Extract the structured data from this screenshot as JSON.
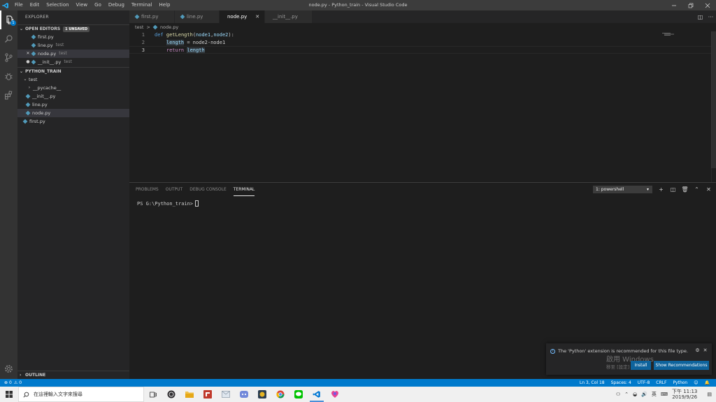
{
  "window": {
    "title": "node.py - Python_train - Visual Studio Code",
    "controls": [
      "minimize",
      "restore",
      "close"
    ]
  },
  "menu": [
    "File",
    "Edit",
    "Selection",
    "View",
    "Go",
    "Debug",
    "Terminal",
    "Help"
  ],
  "activity": {
    "explorer_badge": "1"
  },
  "sidebar": {
    "title": "EXPLORER",
    "open_editors": {
      "label": "OPEN EDITORS",
      "badge": "1 UNSAVED",
      "items": [
        {
          "name": "first.py",
          "desc": ""
        },
        {
          "name": "line.py",
          "desc": "test"
        },
        {
          "name": "node.py",
          "desc": "test"
        },
        {
          "name": "__init__.py",
          "desc": "test"
        }
      ]
    },
    "project": {
      "label": "PYTHON_TRAIN",
      "items": [
        {
          "name": "test"
        },
        {
          "name": "__pycache__"
        },
        {
          "name": "__init__.py"
        },
        {
          "name": "line.py"
        },
        {
          "name": "node.py"
        },
        {
          "name": "first.py"
        }
      ]
    },
    "outline": "OUTLINE"
  },
  "tabs": [
    {
      "label": "first.py"
    },
    {
      "label": "line.py"
    },
    {
      "label": "node.py"
    },
    {
      "label": "__init__.py"
    }
  ],
  "breadcrumb": {
    "folder": "test",
    "sep": ">",
    "file": "node.py"
  },
  "code": {
    "line_numbers": [
      "1",
      "2",
      "3"
    ],
    "line1": {
      "kw": "def",
      "fn": "getLength",
      "open": "(",
      "p1": "node1",
      "comma": ",",
      "p2": "node2",
      "close": "):"
    },
    "line2": {
      "indent": "    ",
      "var": "length",
      "rest": " = node2-node1"
    },
    "line3": {
      "indent": "    ",
      "kw": "return",
      "sp": " ",
      "var": "length"
    }
  },
  "panel": {
    "tabs": [
      "PROBLEMS",
      "OUTPUT",
      "DEBUG CONSOLE",
      "TERMINAL"
    ],
    "terminal_select": "1: powershell",
    "prompt": "PS G:\\Python_train>"
  },
  "notification": {
    "message": "The 'Python' extension is recommended for this file type.",
    "install": "Install",
    "show_recommendations": "Show Recommendations",
    "watermark_line1": "啟用 Windows",
    "watermark_line2": "移至 [設定] 以啟用"
  },
  "status": {
    "errors": "0",
    "warnings": "0",
    "position": "Ln 3, Col 18",
    "spaces": "Spaces: 4",
    "encoding": "UTF-8",
    "eol": "CRLF",
    "language": "Python"
  },
  "taskbar": {
    "search_placeholder": "在這裡輸入文字來搜尋",
    "ime": "英",
    "time": "下午 11:13",
    "date": "2019/9/26"
  },
  "colors": {
    "accent": "#007acc",
    "python_icon": "#519aba",
    "keyword": "#569cd6",
    "function": "#dcdcaa",
    "variable": "#9cdcfe",
    "control": "#c586c0"
  }
}
